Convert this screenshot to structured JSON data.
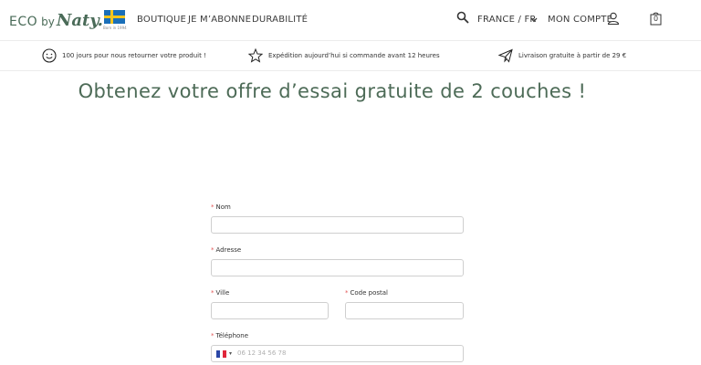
{
  "header": {
    "logo": {
      "eco": "ECO",
      "by": "by",
      "naty": "Naty."
    },
    "flag_caption": "Born in 1994",
    "nav": [
      "BOUTIQUE",
      "JE M’ABONNE",
      "DURABILITÉ"
    ],
    "locale": "FRANCE / FR",
    "account": "MON COMPTE",
    "cart_count": "0",
    "icons": {
      "search": "search-icon",
      "account": "user-icon",
      "cart": "bag-icon",
      "chevron": "chevron-down-icon"
    }
  },
  "banner": [
    {
      "icon": "smiley-icon",
      "text": "100 jours pour nous retourner votre produit !"
    },
    {
      "icon": "star-icon",
      "text": "Expédition aujourd’hui si commande avant 12 heures"
    },
    {
      "icon": "paper-plane-icon",
      "text": "Livraison gratuite à partir de 29 €"
    }
  ],
  "title": "Obtenez votre offre d’essai gratuite de 2 couches !",
  "form": {
    "required_mark": "*",
    "fields": {
      "nom": {
        "label": "Nom",
        "value": ""
      },
      "adresse": {
        "label": "Adresse",
        "value": ""
      },
      "ville": {
        "label": "Ville",
        "value": ""
      },
      "code_postal": {
        "label": "Code postal",
        "value": ""
      },
      "telephone": {
        "label": "Téléphone",
        "placeholder": "06 12 34 56 78",
        "country": "FR"
      }
    }
  },
  "colors": {
    "brand_green": "#4d6b57",
    "required": "#e15656",
    "flag_sweden_blue": "#1a6fb8",
    "flag_sweden_yellow": "#f3c51c",
    "flag_fr_blue": "#2a46a6",
    "flag_fr_red": "#e0263b"
  }
}
